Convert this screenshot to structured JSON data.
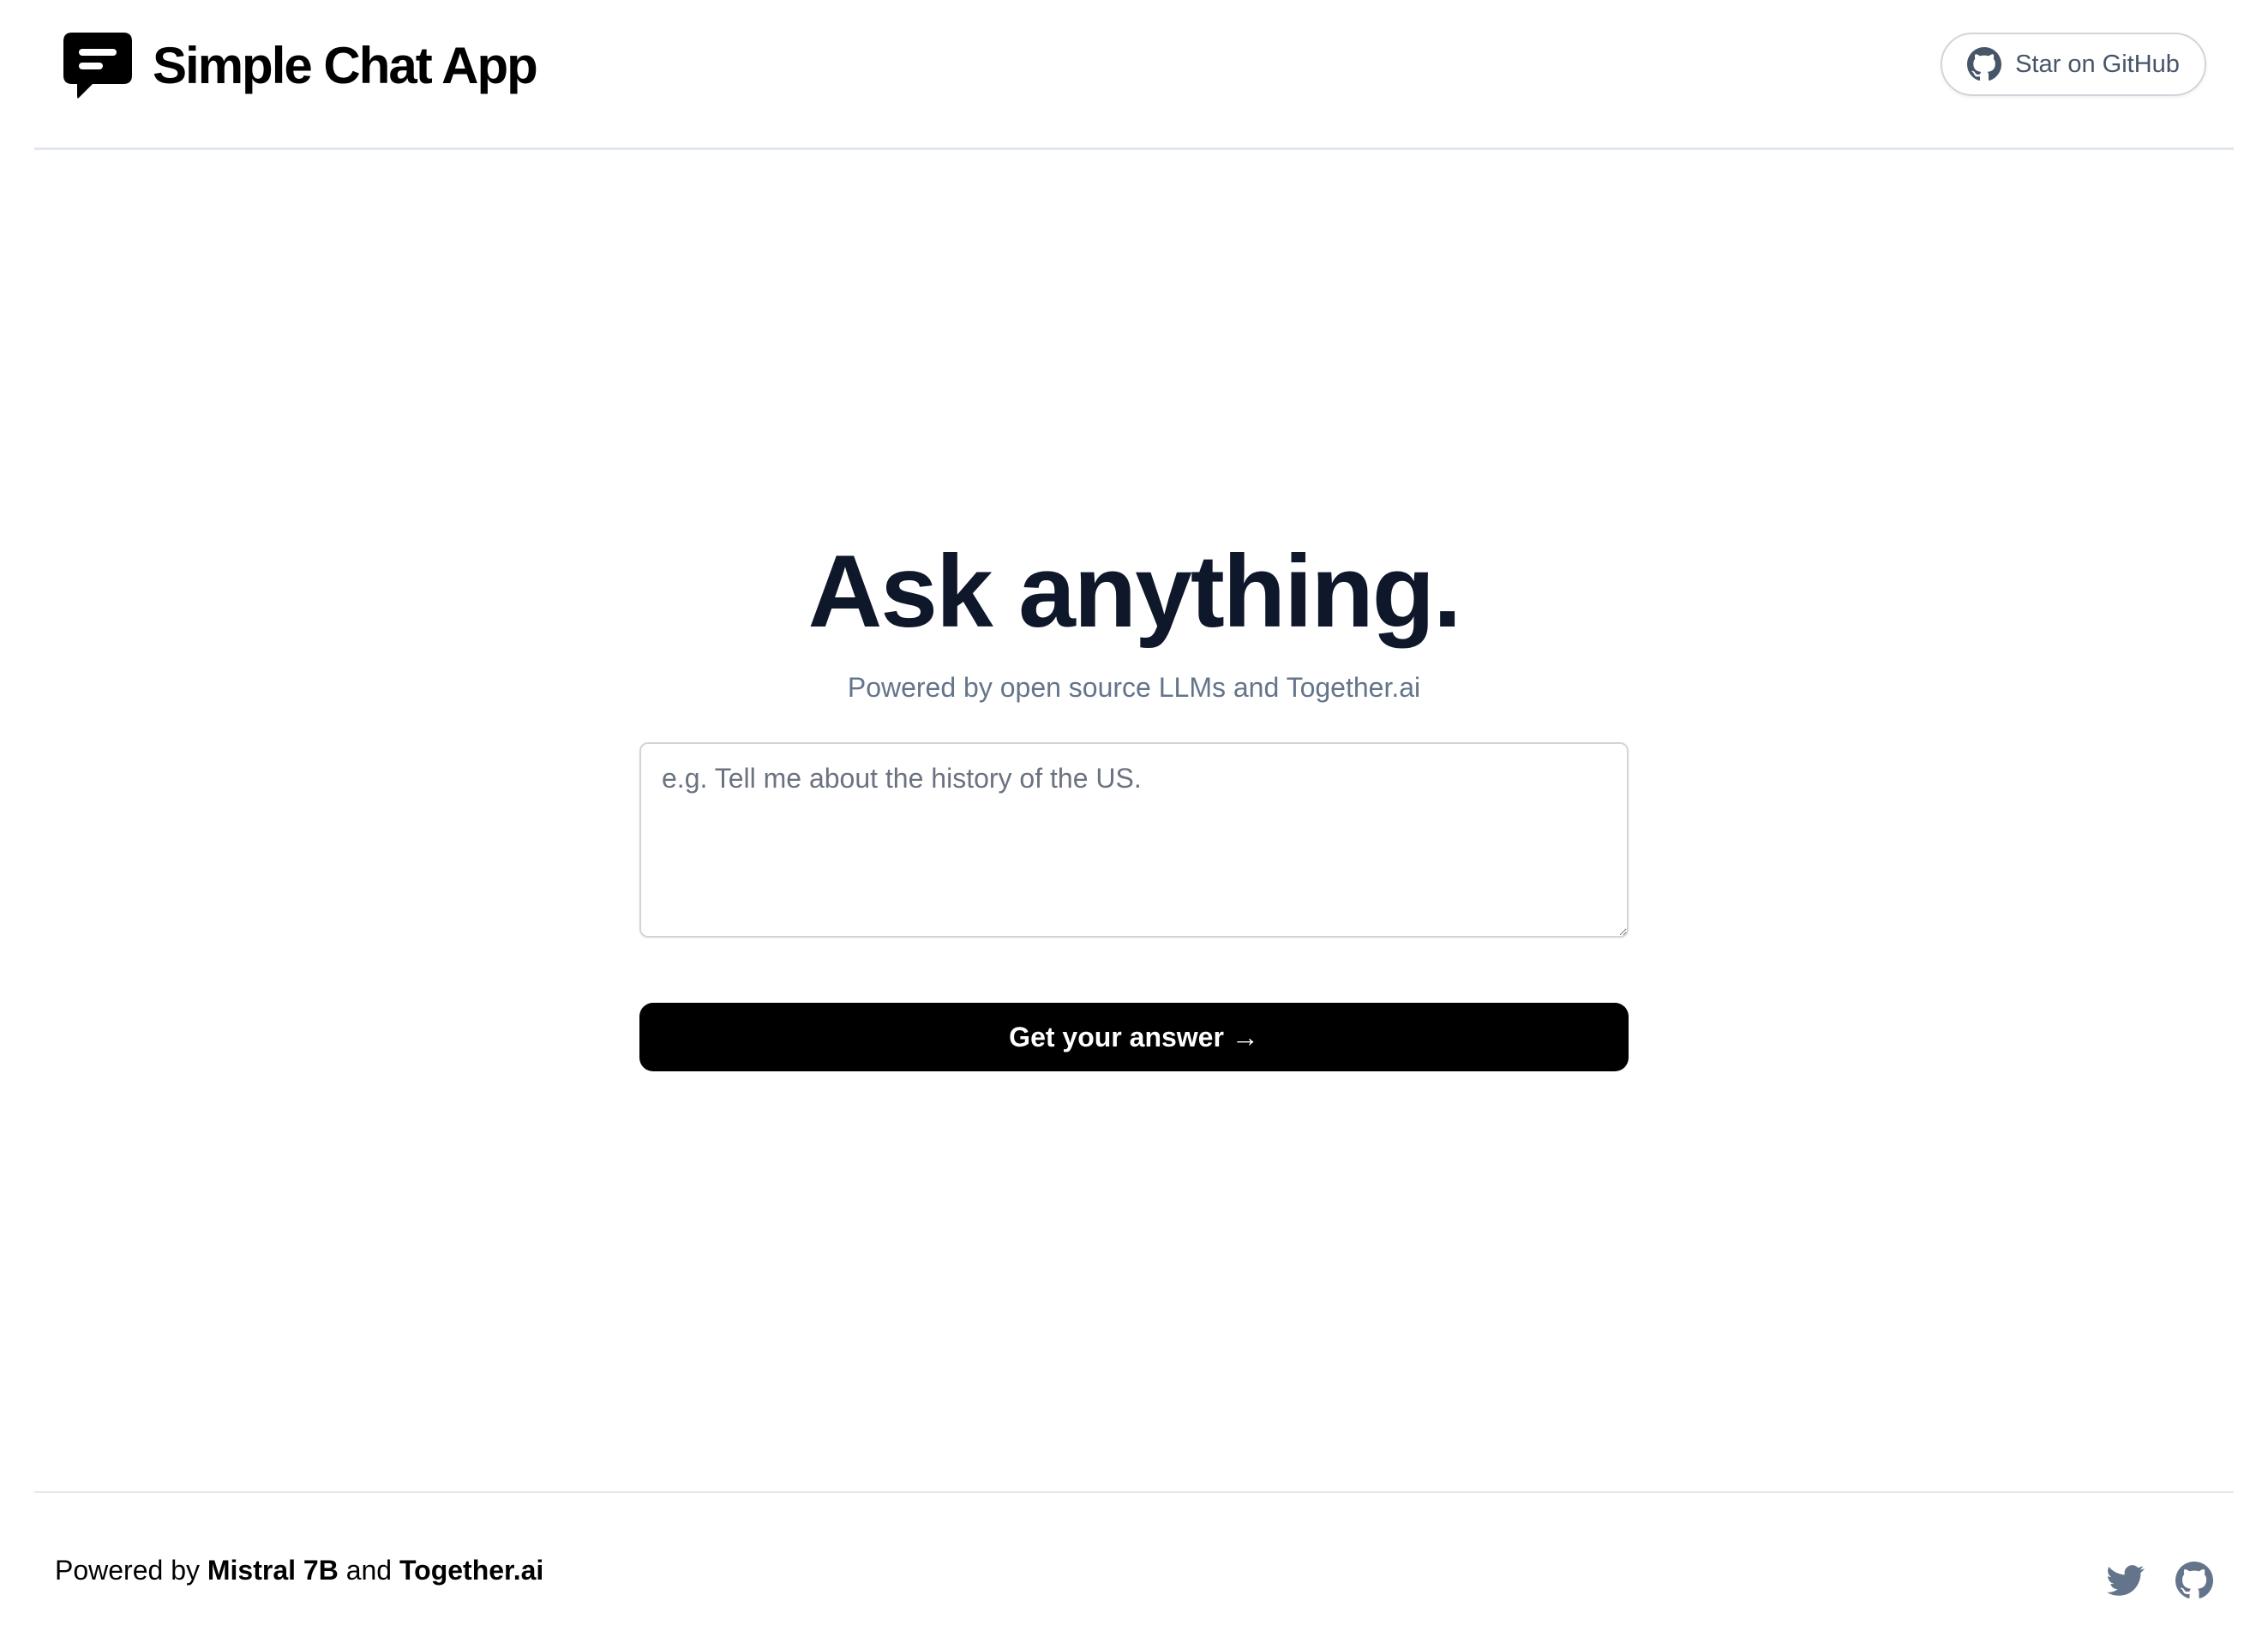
{
  "header": {
    "app_name": "Simple Chat App",
    "logo_icon": "chat-bubble-icon",
    "github_button_label": "Star on GitHub",
    "github_icon": "github-icon"
  },
  "hero": {
    "title": "Ask anything.",
    "subtitle": "Powered by open source LLMs and Together.ai"
  },
  "question": {
    "placeholder": "e.g. Tell me about the history of the US.",
    "value": ""
  },
  "submit": {
    "label": "Get your answer →"
  },
  "footer": {
    "prefix": "Powered by ",
    "model": "Mistral 7B",
    "conjunction": " and ",
    "provider": "Together.ai",
    "icons": [
      "twitter-icon",
      "github-icon"
    ]
  },
  "colors": {
    "text_primary": "#0f172a",
    "text_muted": "#64748b",
    "button_bg": "#000000",
    "border": "#e2e8f0",
    "icon_gray": "#64748b"
  }
}
